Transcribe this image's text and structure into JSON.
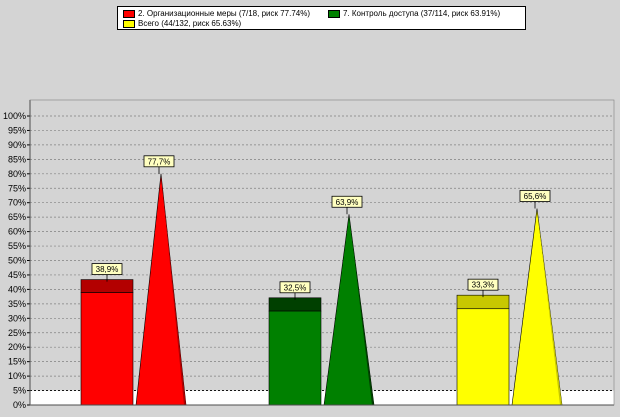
{
  "chart_data": {
    "type": "bar",
    "title": "",
    "xlabel": "",
    "ylabel": "",
    "ylim": [
      0,
      100
    ],
    "y_ticks": [
      "0%",
      "5%",
      "10%",
      "15%",
      "20%",
      "25%",
      "30%",
      "35%",
      "40%",
      "45%",
      "50%",
      "55%",
      "60%",
      "65%",
      "70%",
      "75%",
      "80%",
      "85%",
      "90%",
      "95%",
      "100%"
    ],
    "grid": true,
    "legend_position": "top",
    "threshold_line": 5,
    "groups": [
      {
        "legend": "2. Организационные меры (7/18, риск 77.74%)",
        "color": "#ff0000",
        "dark_color": "#b30000",
        "bar_value": 38.9,
        "bar_total": 43.4,
        "bar_label": "38,9%",
        "risk_value": 80,
        "risk_label": "77,7%"
      },
      {
        "legend": "7. Контроль доступа (37/114, риск 63.91%)",
        "color": "#008000",
        "dark_color": "#004000",
        "bar_value": 32.5,
        "bar_total": 37.1,
        "bar_label": "32,5%",
        "risk_value": 66,
        "risk_label": "63,9%"
      },
      {
        "legend": "Всего (44/132, риск 65.63%)",
        "color": "#ffff00",
        "dark_color": "#c8c800",
        "bar_value": 33.3,
        "bar_total": 38.0,
        "bar_label": "33,3%",
        "risk_value": 68,
        "risk_label": "65,6%"
      }
    ]
  }
}
